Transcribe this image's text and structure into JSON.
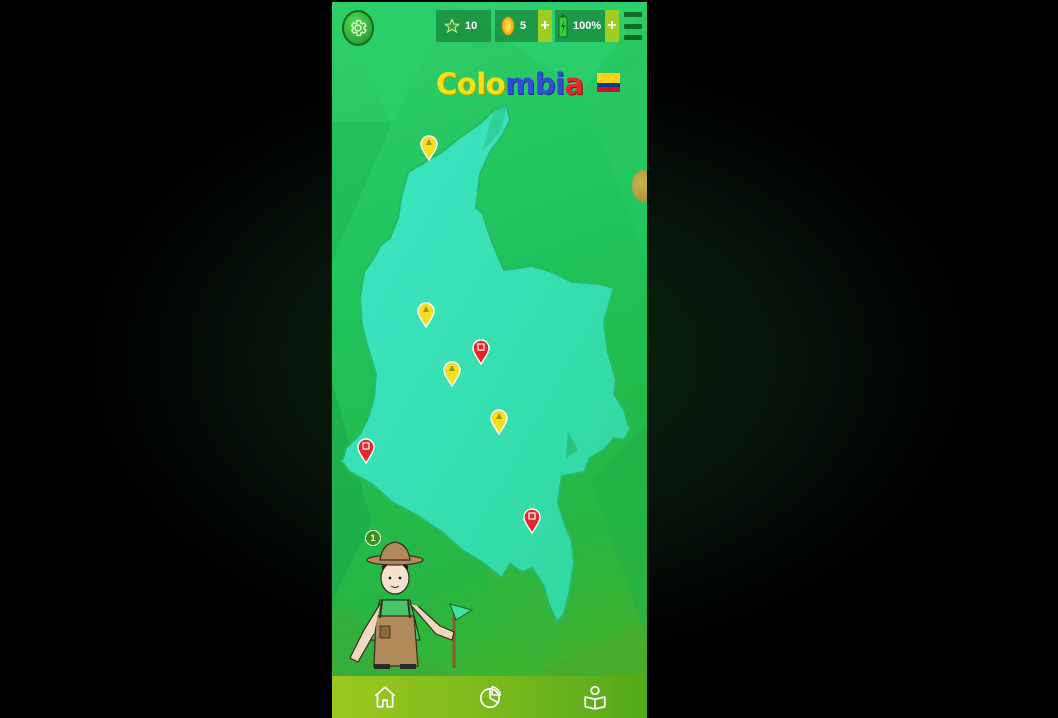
{
  "hud": {
    "stars": "10",
    "coins": "5",
    "energy": "100%",
    "plus_label": "+"
  },
  "title": {
    "part1": "Colo",
    "part2": "mbi",
    "part3": "a"
  },
  "farmer": {
    "level_badge": "1"
  },
  "icons": {
    "settings": "gear-icon",
    "star": "star-icon",
    "coin": "coin-icon",
    "energy": "battery-icon",
    "menu": "hamburger-menu-icon",
    "home": "home-icon",
    "stats": "pie-chart-icon",
    "profile": "user-book-icon"
  },
  "colors": {
    "background": "#1fc25a",
    "map": "#3ee0b0",
    "pin_unlocked": "#f3e01e",
    "pin_locked": "#e2282b",
    "nav_bar": "#8fc21e",
    "flag": [
      "#fcd116",
      "#003893",
      "#ce1126"
    ]
  },
  "pins": [
    {
      "id": "pin-1",
      "status": "unlocked"
    },
    {
      "id": "pin-2",
      "status": "unlocked"
    },
    {
      "id": "pin-3",
      "status": "locked"
    },
    {
      "id": "pin-4",
      "status": "unlocked"
    },
    {
      "id": "pin-5",
      "status": "unlocked"
    },
    {
      "id": "pin-6",
      "status": "locked"
    },
    {
      "id": "pin-7",
      "status": "locked"
    }
  ]
}
